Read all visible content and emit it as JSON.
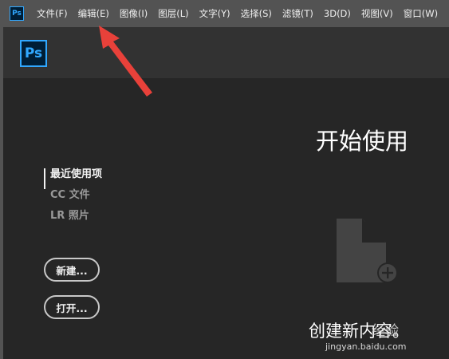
{
  "menubar": {
    "items": [
      {
        "label": "文件(F)"
      },
      {
        "label": "编辑(E)"
      },
      {
        "label": "图像(I)"
      },
      {
        "label": "图层(L)"
      },
      {
        "label": "文字(Y)"
      },
      {
        "label": "选择(S)"
      },
      {
        "label": "滤镜(T)"
      },
      {
        "label": "3D(D)"
      },
      {
        "label": "视图(V)"
      },
      {
        "label": "窗口(W)"
      }
    ],
    "app_icon": "Ps"
  },
  "header": {
    "logo": "Ps"
  },
  "sidebar": {
    "items": [
      {
        "label": "最近使用项",
        "active": true
      },
      {
        "label": "CC 文件"
      },
      {
        "label": "LR 照片"
      }
    ]
  },
  "buttons": {
    "new_label": "新建...",
    "open_label": "打开..."
  },
  "main": {
    "title": "开始使用",
    "create_label": "创建新内容。",
    "create_icon": "new-document-plus-icon"
  },
  "overlay": {
    "watermark_text": "经验",
    "watermark_url": "jingyan.baidu.com",
    "annotation_arrow_color": "#e8413a"
  },
  "colors": {
    "ps_blue": "#31a8ff",
    "menubar_bg": "#535353",
    "app_bg": "#262626",
    "header_bg": "#323232"
  }
}
